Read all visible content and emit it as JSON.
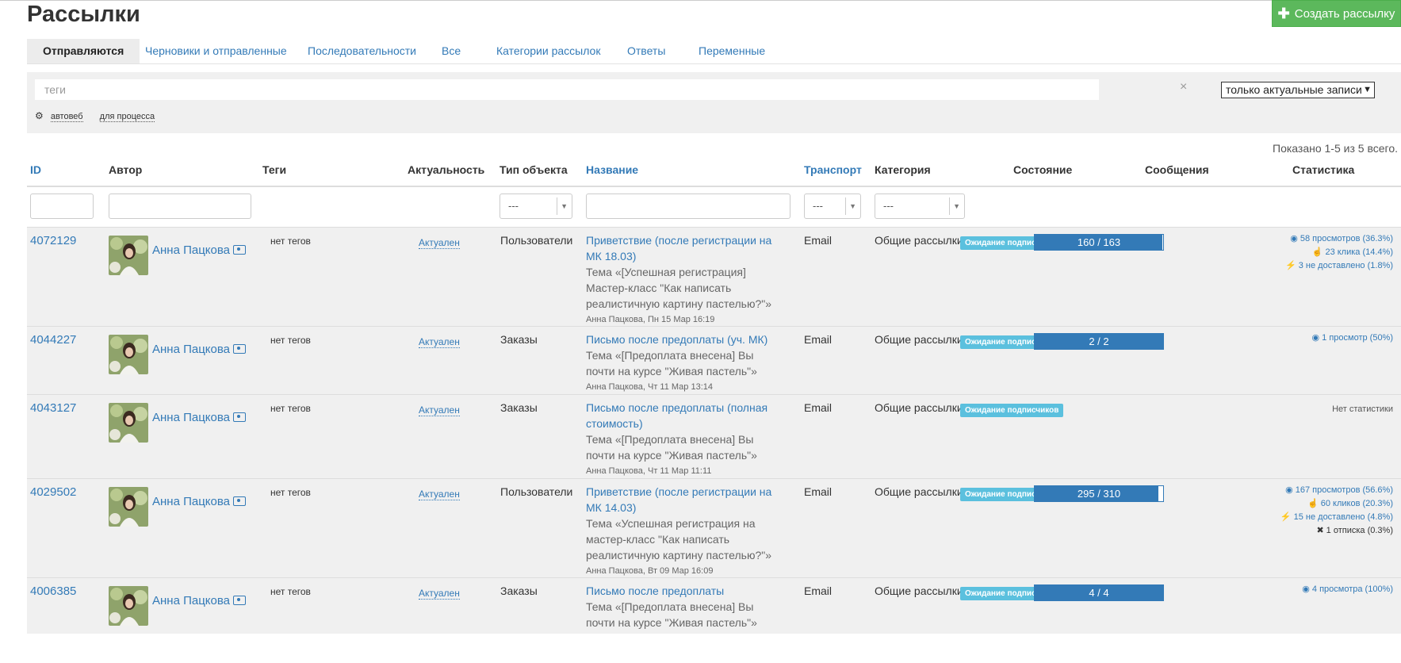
{
  "page": {
    "title": "Рассылки",
    "create_button": "Создать рассылку"
  },
  "tabs": [
    {
      "label": "Отправляются",
      "active": true
    },
    {
      "label": "Черновики и отправленные",
      "active": false
    },
    {
      "label": "Последовательности",
      "active": false
    },
    {
      "label": "Все",
      "active": false
    },
    {
      "label": "Категории рассылок",
      "active": false
    },
    {
      "label": "Ответы",
      "active": false
    },
    {
      "label": "Переменные",
      "active": false
    }
  ],
  "filters": {
    "tags_placeholder": "теги",
    "clear_symbol": "×",
    "actual_select": "только актуальные записи",
    "tag_chips": [
      "автовеб",
      "для процесса"
    ]
  },
  "summary": "Показано 1-5 из 5 всего.",
  "columns": {
    "id": "ID",
    "author": "Автор",
    "tags": "Теги",
    "actuality": "Актуальность",
    "object_type": "Тип объекта",
    "name": "Название",
    "transport": "Транспорт",
    "category": "Категория",
    "state": "Состояние",
    "messages": "Сообщения",
    "stats": "Статистика"
  },
  "filter_selects": {
    "object_type": "---",
    "transport": "---",
    "category": "---"
  },
  "rows": [
    {
      "id": "4072129",
      "author": "Анна Пацкова",
      "tags": "нет тегов",
      "actuality": "Актуален",
      "object_type": "Пользователи",
      "title": "Приветствие (после регистрации на МК 18.03)",
      "subject": "Тема «[Успешная регистрация] Мастер-класс \"Как написать реалистичную картину пастелью?\"»",
      "meta": "Анна Пацкова, Пн 15 Мар 16:19",
      "transport": "Email",
      "category": "Общие рассылки",
      "status": "Ожидание подписчиков",
      "messages_label": "160 / 163",
      "sent_fraction": 0.982,
      "stats": [
        "58 просмотров (36.3%)",
        "23 клика (14.4%)",
        "3 не доставлено (1.8%)"
      ]
    },
    {
      "id": "4044227",
      "author": "Анна Пацкова",
      "tags": "нет тегов",
      "actuality": "Актуален",
      "object_type": "Заказы",
      "title": "Письмо после предоплаты (уч. МК)",
      "subject": "Тема «[Предоплата внесена] Вы почти на курсе \"Живая пастель\"»",
      "meta": "Анна Пацкова, Чт 11 Мар 13:14",
      "transport": "Email",
      "category": "Общие рассылки",
      "status": "Ожидание подписчиков",
      "messages_label": "2 / 2",
      "sent_fraction": 1.0,
      "stats": [
        "1 просмотр (50%)"
      ]
    },
    {
      "id": "4043127",
      "author": "Анна Пацкова",
      "tags": "нет тегов",
      "actuality": "Актуален",
      "object_type": "Заказы",
      "title": "Письмо после предоплаты (полная стоимость)",
      "subject": "Тема «[Предоплата внесена] Вы почти на курсе \"Живая пастель\"»",
      "meta": "Анна Пацкова, Чт 11 Мар 11:11",
      "transport": "Email",
      "category": "Общие рассылки",
      "status": "Ожидание подписчиков",
      "messages_label": "",
      "sent_fraction": 0,
      "stats_none": "Нет статистики"
    },
    {
      "id": "4029502",
      "author": "Анна Пацкова",
      "tags": "нет тегов",
      "actuality": "Актуален",
      "object_type": "Пользователи",
      "title": "Приветствие (после регистрации на МК 14.03)",
      "subject": "Тема «Успешная регистрация на мастер-класс \"Как написать реалистичную картину пастелью?\"»",
      "meta": "Анна Пацкова, Вт 09 Мар 16:09",
      "transport": "Email",
      "category": "Общие рассылки",
      "status": "Ожидание подписчиков",
      "messages_label": "295 / 310",
      "sent_fraction": 0.952,
      "stats": [
        "167 просмотров (56.6%)",
        "60 кликов (20.3%)",
        "15 не доставлено (4.8%)"
      ],
      "stats_extra": "1 отписка (0.3%)"
    },
    {
      "id": "4006385",
      "author": "Анна Пацкова",
      "tags": "нет тегов",
      "actuality": "Актуален",
      "object_type": "Заказы",
      "title": "Письмо после предоплаты",
      "subject": "Тема «[Предоплата внесена] Вы почти на курсе \"Живая пастель\"»",
      "meta": "",
      "transport": "Email",
      "category": "Общие рассылки",
      "status": "Ожидание подписчиков",
      "messages_label": "4 / 4",
      "sent_fraction": 1.0,
      "stats": [
        "4 просмотра (100%)"
      ]
    }
  ]
}
